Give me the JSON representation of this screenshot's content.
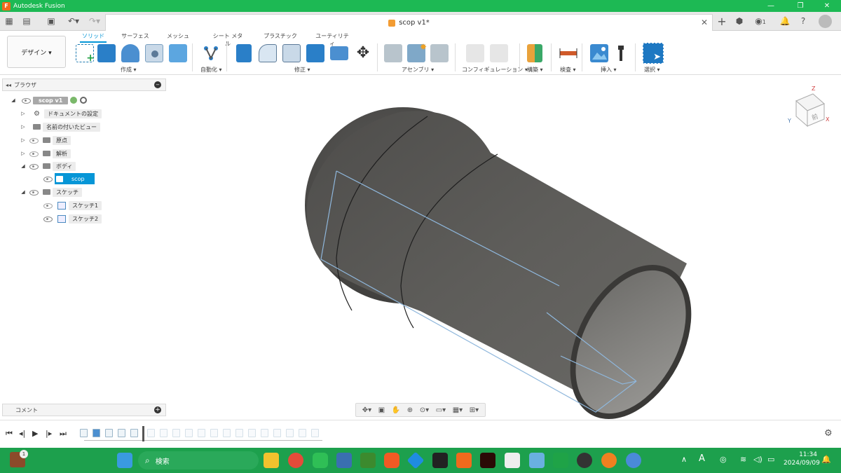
{
  "titlebar": {
    "title": "Autodesk Fusion",
    "minimize": "—",
    "maximize": "❐",
    "close": "✕"
  },
  "document_tab": {
    "title": "scop v1*",
    "close": "✕"
  },
  "header": {
    "notifications": "1"
  },
  "workspace": {
    "label": "デザイン ▾"
  },
  "toolbar": {
    "tabs": [
      "ソリッド",
      "サーフェス",
      "メッシュ",
      "シート メタル",
      "プラスチック",
      "ユーティリティ"
    ],
    "groups": [
      "作成 ▾",
      "自動化 ▾",
      "修正 ▾",
      "アセンブリ ▾",
      "コンフィギュレーション ▾",
      "構築 ▾",
      "検査 ▾",
      "挿入 ▾",
      "選択 ▾"
    ]
  },
  "browser": {
    "title": "ブラウザ",
    "root": "scop v1",
    "items": [
      {
        "label": "ドキュメントの設定"
      },
      {
        "label": "名前の付いたビュー"
      },
      {
        "label": "原点"
      },
      {
        "label": "解析"
      },
      {
        "label": "ボディ"
      },
      {
        "label": "scop"
      },
      {
        "label": "スケッチ"
      },
      {
        "label": "スケッチ1"
      },
      {
        "label": "スケッチ2"
      }
    ]
  },
  "comments": {
    "label": "コメント"
  },
  "viewcube": {
    "face": "前",
    "z": "Z",
    "x": "X",
    "y": "Y"
  },
  "taskbar": {
    "search_label": "検索",
    "language": "A",
    "time": "11:34",
    "date": "2024/09/09",
    "badge": "1"
  },
  "colors": {
    "titlebar": "#1db954",
    "accent": "#0696d7",
    "taskbar": "#1da04d",
    "body": "#5a5a58"
  }
}
